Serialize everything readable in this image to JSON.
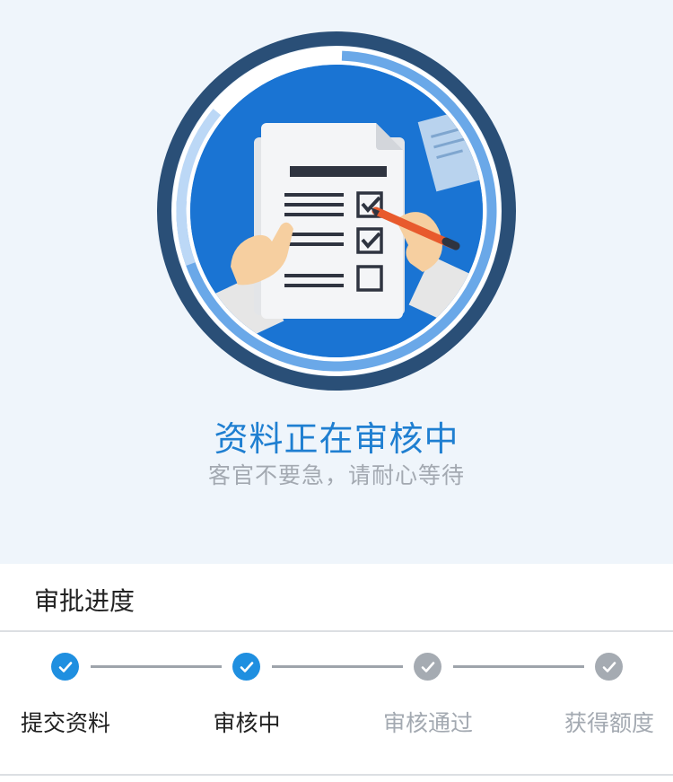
{
  "status": {
    "title": "资料正在审核中",
    "subtitle": "客官不要急，请耐心等待"
  },
  "progress": {
    "title": "审批进度",
    "steps": [
      {
        "label": "提交资料",
        "state": "done"
      },
      {
        "label": "审核中",
        "state": "done"
      },
      {
        "label": "审核通过",
        "state": "pending"
      },
      {
        "label": "获得额度",
        "state": "pending"
      }
    ]
  },
  "colors": {
    "accent": "#1f7fd1",
    "step_done": "#1f8fe0",
    "step_pending": "#a5abb2",
    "hero_bg": "#eff5fb"
  },
  "icons": [
    "document-review-illustration",
    "check-icon"
  ]
}
